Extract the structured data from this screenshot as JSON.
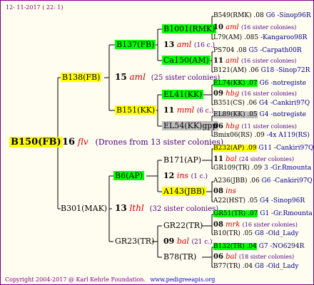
{
  "header": {
    "date_text": "12- 11-2017 ( 22: 1)"
  },
  "footer": {
    "copyright": "Copyright 2004-2017 @ Karl Kehrle Foundation.",
    "website": "www.pedigreeapis.org"
  },
  "root": {
    "id": "B150(FB)",
    "drone_num": "16",
    "drone_ped": "flv",
    "drone_note": "(Drones from 13 sister colonies)"
  },
  "p1": {
    "id": "B138(FB)",
    "num": "15",
    "ped": "aml",
    "note": "(25 sister colonies)"
  },
  "p2": {
    "id": "B301(MAK)",
    "num": "13",
    "ped": "lthl",
    "note": "(32 sister colonies)"
  },
  "g3": [
    {
      "id": "B137(FB)",
      "num": "13",
      "ped": "aml",
      "note": "(16 c.)"
    },
    {
      "id": "B151(KK)",
      "num": "11",
      "ped": "mml",
      "note": "(6 c.)"
    },
    {
      "id": "B6(AP)",
      "num": "12",
      "ped": "ins",
      "note": "(1 c.)"
    },
    {
      "id": "GR23(TR)",
      "num": "09",
      "ped": "bal",
      "note": "(21 c.)"
    }
  ],
  "g4": [
    {
      "id": "B1001(RMK)",
      "num": "10",
      "ped": "aml",
      "note": "(16 sister colonies)",
      "top": "B549(RMK) .08",
      "top_r": "G6 -Sinop96R",
      "bot": "L79(AM) .085",
      "bot_r": "-Kangaroo98R"
    },
    {
      "id": "Ca150(AM)",
      "num": "11",
      "ped": "aml",
      "note": "(16 sister colonies)",
      "top": "PS704 .08",
      "top_r": "G5 -Carpath00R",
      "bot": "B121(AM) .06",
      "bot_r": "G18 -Sinop72R"
    },
    {
      "id": "EL41(KK)",
      "num": "09",
      "ped": "hbg",
      "note": "(16 sister colonies)",
      "top": "EL74(KK) .07",
      "top_r": "G6 -notregiste",
      "bot": "B351(CS) .06",
      "bot_r": "G4 -Cankiri97Q"
    },
    {
      "id": "EL54(KK)gpp",
      "num": "06",
      "ped": "hbg",
      "note": "(11 sister colonies)",
      "top": "EL89(KK) .05",
      "top_r": "G4 -notregiste",
      "bot": "Bmix06(RS) .09",
      "bot_r": "-4x A119(RS)"
    },
    {
      "id": "B171(AP)",
      "num": "11",
      "ped": "bal",
      "note": "(24 sister colonies)",
      "top": "B232(AP) .09",
      "top_r": "G11 -Cankiri97Q",
      "bot": "GR109(TR) .09",
      "bot_r": "3 -Gr.Rmounta"
    },
    {
      "id": "A143(JBB)",
      "num": "08",
      "ped": "ins",
      "note": "",
      "top": "A236(JBB) .06",
      "top_r": "G6 -Cankiri97Q",
      "bot": "A22(HST) .05",
      "bot_r": "G4 -Sinop96R"
    },
    {
      "id": "GR22(TR)",
      "num": "08",
      "ped": "mrk",
      "note": "(16 sister colonies)",
      "top": "GR51(TR) .07",
      "top_r": "G1 -Gr.Rmounta",
      "bot": "B10(TR) .05",
      "bot_r": "G8 -Old_Lady"
    },
    {
      "id": "B78(TR)",
      "num": "06",
      "ped": "bal",
      "note": "(18 sister colonies)",
      "top": "B132(TR) .04",
      "top_r": "G7 -NO6294R",
      "bot": "B77(TR) .04",
      "bot_r": "G8 -Old_Lady"
    }
  ]
}
